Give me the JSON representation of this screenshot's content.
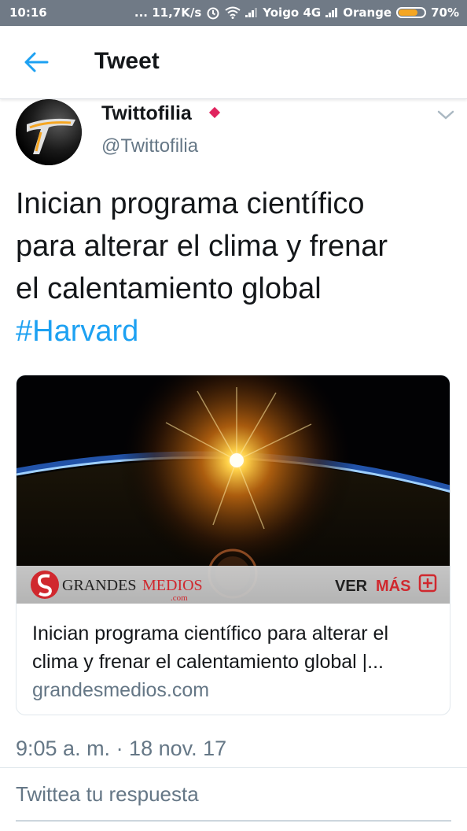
{
  "status_bar": {
    "time": "10:16",
    "network_speed": "... 11,7K/s",
    "carrier1": "Yoigo 4G",
    "carrier2": "Orange",
    "battery": "70%",
    "battery_level": 0.7
  },
  "header": {
    "title": "Tweet",
    "back_icon": "arrow-left-icon"
  },
  "tweet": {
    "author_name": "Twittofilia",
    "author_handle": "@Twittofilia",
    "text_lines": [
      "Inician programa científico",
      "para alterar el clima y frenar",
      "el calentamiento global"
    ],
    "hashtag": "#Harvard",
    "timestamp": "9:05 a. m. · 18 nov. 17"
  },
  "card": {
    "banner_brand_grandes": "GRANDES",
    "banner_brand_medios": "MEDIOS",
    "banner_brand_com": ".com",
    "banner_ver": "VER",
    "banner_mas": "MÁS",
    "title": "Inician programa científico para alterar el clima y frenar el calentamiento global |...",
    "domain": "grandesmedios.com"
  },
  "reply": {
    "placeholder": "Twittea tu respuesta"
  },
  "colors": {
    "accent": "#1da1f2",
    "secondary_text": "#657786",
    "status_bar_bg": "#707a86",
    "brand_red": "#d0282e",
    "verified_pink": "#e0245e"
  }
}
